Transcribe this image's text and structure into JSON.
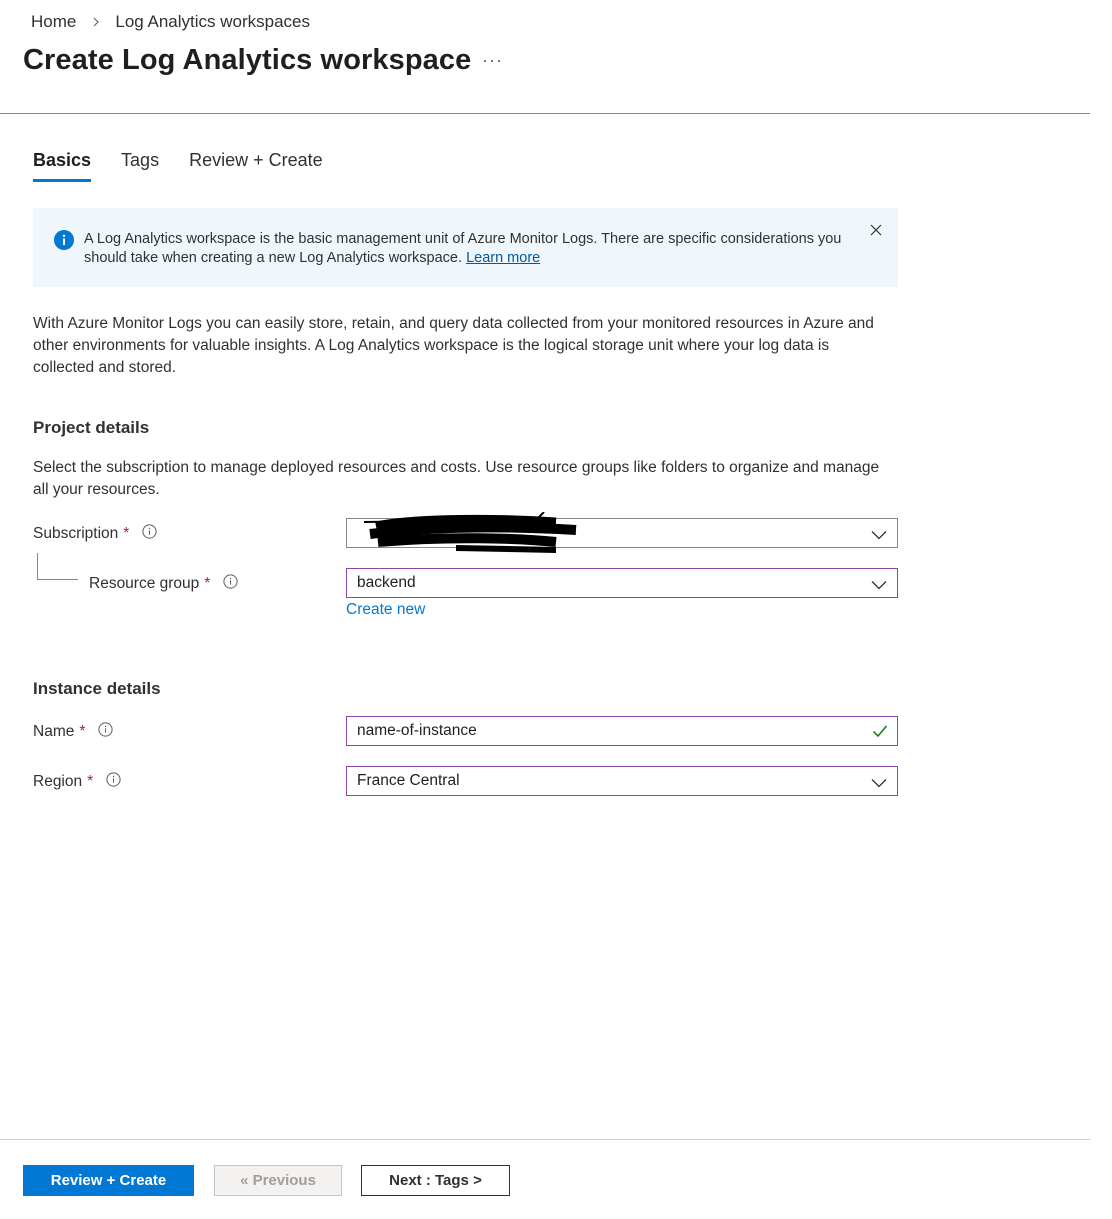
{
  "breadcrumb": {
    "home": "Home",
    "current": "Log Analytics workspaces"
  },
  "page": {
    "title": "Create Log Analytics workspace",
    "more": "···"
  },
  "tabs": [
    {
      "label": "Basics",
      "active": true
    },
    {
      "label": "Tags",
      "active": false
    },
    {
      "label": "Review + Create",
      "active": false
    }
  ],
  "banner": {
    "text": "A Log Analytics workspace is the basic management unit of Azure Monitor Logs. There are specific considerations you should take when creating a new Log Analytics workspace.",
    "link": "Learn more"
  },
  "intro": "With Azure Monitor Logs you can easily store, retain, and query data collected from your monitored resources in Azure and other environments for valuable insights. A Log Analytics workspace is the logical storage unit where your log data is collected and stored.",
  "project": {
    "title": "Project details",
    "desc": "Select the subscription to manage deployed resources and costs. Use resource groups like folders to organize and manage all your resources.",
    "subscription_label": "Subscription",
    "subscription_value": "",
    "resource_group_label": "Resource group",
    "resource_group_value": "backend",
    "create_new": "Create new"
  },
  "instance": {
    "title": "Instance details",
    "name_label": "Name",
    "name_value": "name-of-instance",
    "region_label": "Region",
    "region_value": "France Central"
  },
  "required_mark": "*",
  "footer": {
    "review_create": "Review + Create",
    "previous": "« Previous",
    "next": "Next : Tags >"
  },
  "colors": {
    "accent": "#0078d4",
    "focus_border": "#8e44ad",
    "required": "#a4262c",
    "banner_bg": "#eff6fc",
    "valid": "#107c10"
  }
}
